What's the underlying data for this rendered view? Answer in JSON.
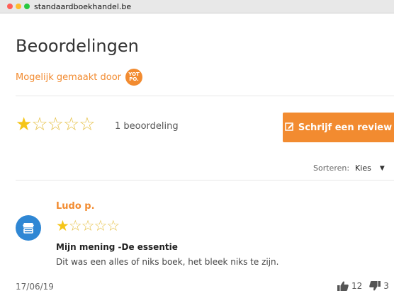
{
  "window": {
    "title": "standaardboekhandel.be",
    "dots": [
      "#ff5f57",
      "#febc2e",
      "#28c840"
    ]
  },
  "colors": {
    "accent": "#f28b30",
    "star": "#f5c518",
    "avatar": "#2f87d4"
  },
  "widget": {
    "heading": "Beoordelingen",
    "powered_by": "Mogelijk gemaakt door",
    "badge_line1": "YOT",
    "badge_line2": "PO."
  },
  "summary": {
    "rating": 1,
    "max_rating": 5,
    "count_label": "1 beoordeling",
    "write_review_label": "Schrijf een review",
    "write_review_icon": "edit-icon"
  },
  "sort": {
    "label": "Sorteren:",
    "selected": "Kies"
  },
  "review": {
    "author": "Ludo p.",
    "avatar_icon": "store-icon",
    "rating": 1,
    "max_rating": 5,
    "title": "Mijn mening -De essentie",
    "body": "Dit was een alles of niks boek, het bleek niks te zijn.",
    "date": "17/06/19",
    "votes_up": "12",
    "votes_down": "3"
  }
}
